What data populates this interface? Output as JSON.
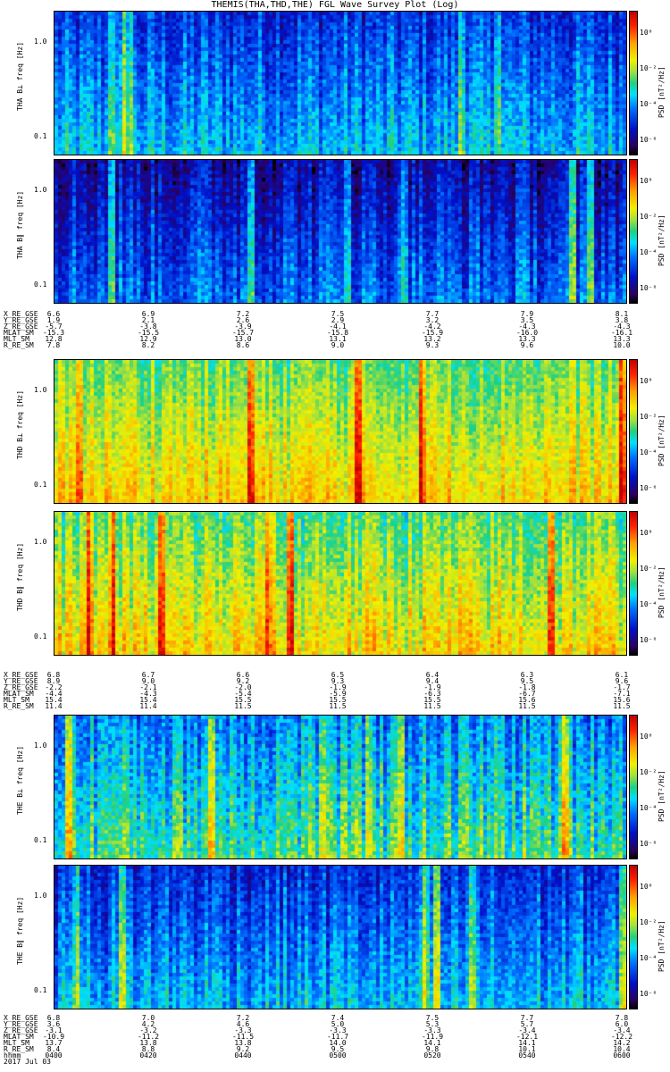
{
  "title": "THEMIS(THA,THD,THE) FGL Wave Survey Plot (Log)",
  "yaxis_label_suffix": "freq [Hz]",
  "yticks": [
    "1.0",
    "0.1"
  ],
  "colorbar": {
    "label": "PSD [nT²/Hz]",
    "ticks": [
      "10⁰",
      "10⁻²",
      "10⁻⁴",
      "10⁻⁶"
    ]
  },
  "date": "2017 Jul 03",
  "chart_data": [
    {
      "type": "heatmap",
      "panel": "THA B⊥",
      "ylabel": "THA B⊥",
      "yscale": "log",
      "ylim": [
        0.05,
        2.0
      ],
      "colormap": "rainbow",
      "description_level": "low-moderate power, blue dominated"
    },
    {
      "type": "heatmap",
      "panel": "THA B∥",
      "ylabel": "THA B∥",
      "yscale": "log",
      "ylim": [
        0.05,
        2.0
      ],
      "colormap": "rainbow",
      "description_level": "low power, blue/purple dominated"
    },
    {
      "type": "heatmap",
      "panel": "THD B⊥",
      "ylabel": "THD B⊥",
      "yscale": "log",
      "ylim": [
        0.05,
        2.0
      ],
      "colormap": "rainbow",
      "description_level": "high power, yellow/green dominated"
    },
    {
      "type": "heatmap",
      "panel": "THD B∥",
      "ylabel": "THD B∥",
      "yscale": "log",
      "ylim": [
        0.05,
        2.0
      ],
      "colormap": "rainbow",
      "description_level": "high power, yellow/green dominated"
    },
    {
      "type": "heatmap",
      "panel": "THE B⊥",
      "ylabel": "THE B⊥",
      "yscale": "log",
      "ylim": [
        0.05,
        2.0
      ],
      "colormap": "rainbow",
      "description_level": "moderate power, cyan/green with yellow bursts"
    },
    {
      "type": "heatmap",
      "panel": "THE B∥",
      "ylabel": "THE B∥",
      "yscale": "log",
      "ylim": [
        0.05,
        2.0
      ],
      "colormap": "rainbow",
      "description_level": "low-moderate power, blue/cyan dominated"
    }
  ],
  "ephemeris": [
    {
      "rows": [
        "X_RE_GSE",
        "Y_RE_GSE",
        "Z_RE_GSE",
        "MLAT_SM",
        "MLT_SM",
        "R_RE_SM"
      ],
      "columns": [
        [
          "6.6",
          "1.9",
          "-5.7",
          "-15.3",
          "12.8",
          "7.8"
        ],
        [
          "6.9",
          "2.1",
          "-3.8",
          "-15.5",
          "12.9",
          "8.2"
        ],
        [
          "7.2",
          "2.6",
          "-3.9",
          "-15.7",
          "13.0",
          "8.6"
        ],
        [
          "7.5",
          "2.9",
          "-4.1",
          "-15.8",
          "13.1",
          "9.0"
        ],
        [
          "7.7",
          "3.2",
          "-4.2",
          "-15.9",
          "13.2",
          "9.3"
        ],
        [
          "7.9",
          "3.5",
          "-4.3",
          "-16.0",
          "13.3",
          "9.6"
        ],
        [
          "8.1",
          "3.8",
          "-4.3",
          "-16.1",
          "13.3",
          "10.0"
        ]
      ]
    },
    {
      "rows": [
        "X_RE_GSE",
        "Y_RE_GSE",
        "Z_RE_GSE",
        "MLAT_SM",
        "MLT_SM",
        "R_RE_SM"
      ],
      "columns": [
        [
          "6.8",
          "8.9",
          "-2.2",
          "-4.4",
          "15.4",
          "11.4"
        ],
        [
          "6.7",
          "9.0",
          "-2.1",
          "-4.3",
          "15.4",
          "11.4"
        ],
        [
          "6.6",
          "9.2",
          "-2.0",
          "-5.4",
          "15.5",
          "11.5"
        ],
        [
          "6.5",
          "9.3",
          "-1.9",
          "-5.9",
          "15.5",
          "11.5"
        ],
        [
          "6.4",
          "9.4",
          "-1.9",
          "-6.3",
          "15.5",
          "11.5"
        ],
        [
          "6.3",
          "9.5",
          "-1.8",
          "-6.7",
          "15.6",
          "11.5"
        ],
        [
          "6.1",
          "9.6",
          "-1.7",
          "-7.1",
          "15.6",
          "11.5"
        ]
      ]
    },
    {
      "rows": [
        "X_RE_GSE",
        "Y_RE_GSE",
        "Z_RE_GSE",
        "MLAT_SM",
        "MLT_SM",
        "R_RE_SM",
        "hhmm"
      ],
      "columns": [
        [
          "6.8",
          "3.6",
          "-3.1",
          "-10.9",
          "13.7",
          "8.4",
          "0400"
        ],
        [
          "7.0",
          "4.2",
          "-3.2",
          "-11.2",
          "13.8",
          "8.8",
          "0420"
        ],
        [
          "7.2",
          "4.6",
          "-3.3",
          "-11.5",
          "13.8",
          "9.2",
          "0440"
        ],
        [
          "7.4",
          "5.0",
          "-3.3",
          "-11.7",
          "14.0",
          "9.5",
          "0500"
        ],
        [
          "7.5",
          "5.3",
          "-3.3",
          "-11.9",
          "14.1",
          "9.8",
          "0520"
        ],
        [
          "7.7",
          "5.7",
          "-3.4",
          "-12.1",
          "14.1",
          "10.1",
          "0540"
        ],
        [
          "7.8",
          "6.0",
          "-3.4",
          "-12.2",
          "14.2",
          "10.4",
          "0600"
        ]
      ]
    }
  ]
}
